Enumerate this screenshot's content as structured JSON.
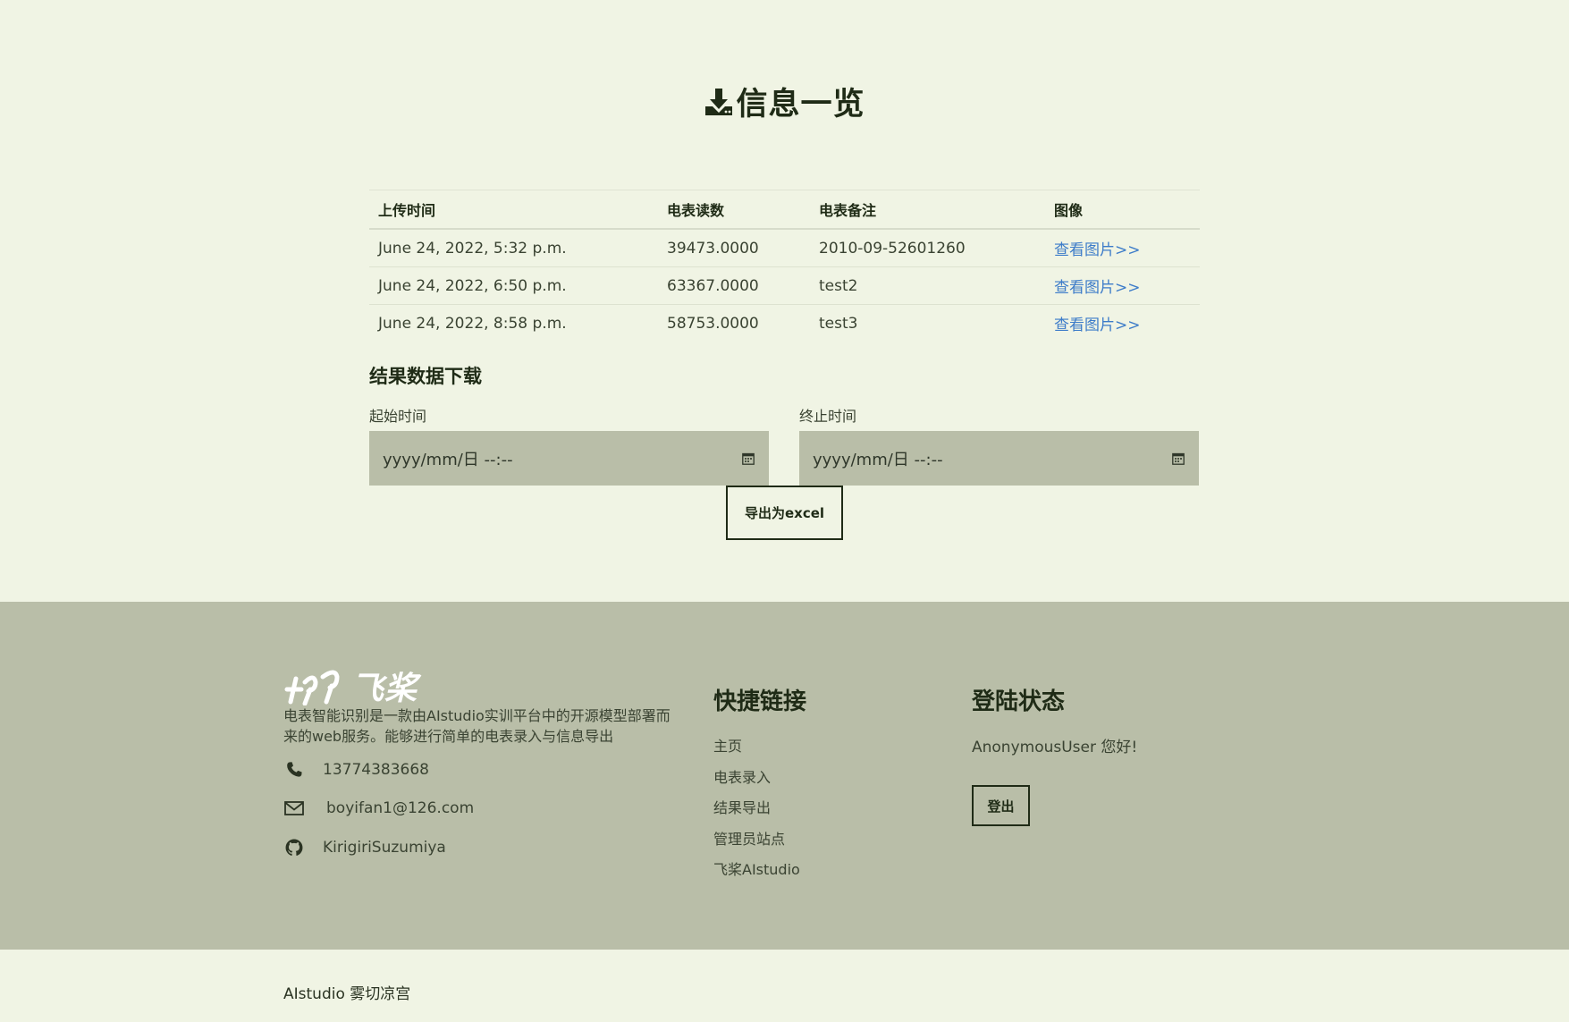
{
  "header": {
    "title": "信息一览",
    "title_icon": "download-icon"
  },
  "table": {
    "columns": [
      "上传时间",
      "电表读数",
      "电表备注",
      "图像"
    ],
    "rows": [
      {
        "time": "June 24, 2022, 5:32 p.m.",
        "reading": "39473.0000",
        "note": "2010-09-52601260",
        "image_link": "查看图片>>"
      },
      {
        "time": "June 24, 2022, 6:50 p.m.",
        "reading": "63367.0000",
        "note": "test2",
        "image_link": "查看图片>>"
      },
      {
        "time": "June 24, 2022, 8:58 p.m.",
        "reading": "58753.0000",
        "note": "test3",
        "image_link": "查看图片>>"
      }
    ]
  },
  "download": {
    "heading": "结果数据下载",
    "start_label": "起始时间",
    "end_label": "终止时间",
    "start_placeholder": "yyyy/mm/日 --:--",
    "end_placeholder": "yyyy/mm/日 --:--",
    "export_label": "导出为excel"
  },
  "footer": {
    "logo_text": "飞桨",
    "about": "电表智能识别是一款由AIstudio实训平台中的开源模型部署而来的web服务。能够进行简单的电表录入与信息导出",
    "phone": "13774383668",
    "email": "boyifan1@126.com",
    "github": "KirigiriSuzumiya",
    "quick_links_heading": "快捷链接",
    "quick_links": [
      "主页",
      "电表录入",
      "结果导出",
      "管理员站点",
      "飞桨AIstudio"
    ],
    "login_heading": "登陆状态",
    "greeting": "AnonymousUser 您好!",
    "logout_label": "登出"
  },
  "copyright": "AIstudio 雾切凉宫",
  "colors": {
    "background": "#f0f4e4",
    "footer_bg": "#b9bea8",
    "input_bg": "#b9bea8",
    "text_dark": "#1f2b16",
    "link": "#3d7cc9"
  }
}
